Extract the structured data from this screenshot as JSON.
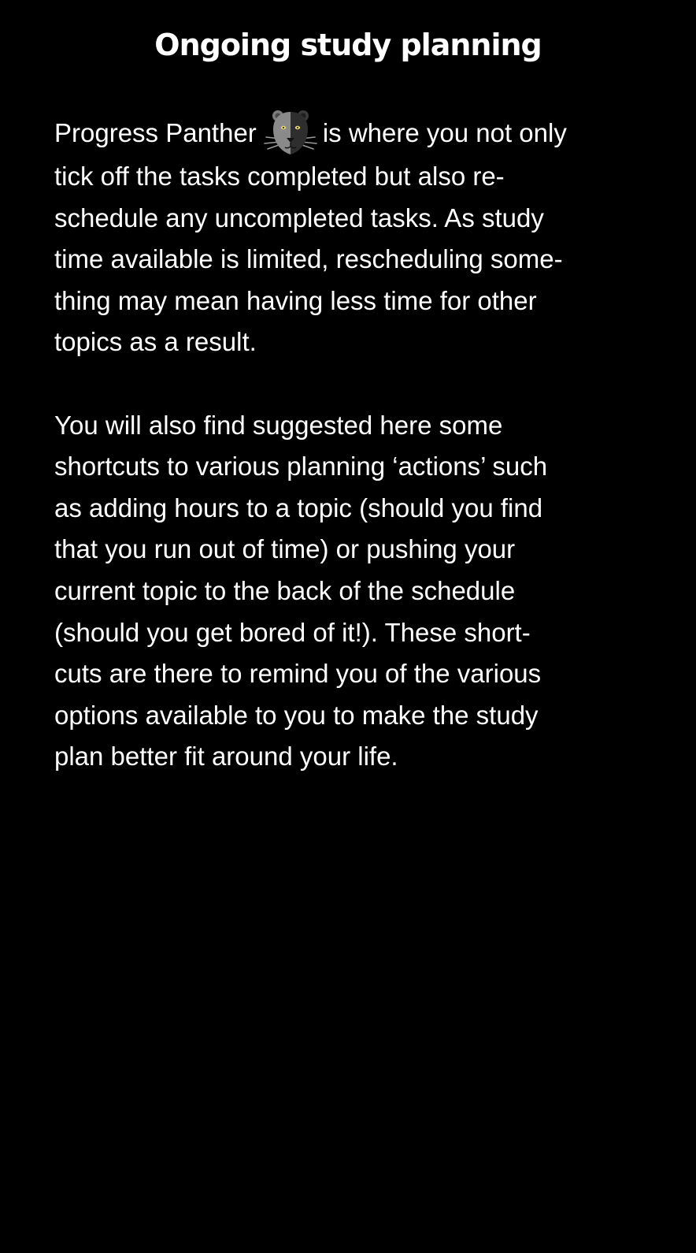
{
  "title": "Ongoing study planning",
  "paragraph1": {
    "lead": "Progress Panther",
    "icon": "panther-icon",
    "lines": [
      "is where you not only",
      "tick off the tasks completed but also re-",
      "schedule any uncompleted tasks. As study",
      "time available is limited, rescheduling some-",
      "thing may mean having less time for other",
      "topics as a result."
    ]
  },
  "paragraph2": {
    "lines": [
      "You will also find suggested here some",
      "shortcuts to various planning ‘actions’ such",
      "as adding hours to a topic (should you find",
      "that you run out of time) or pushing your",
      "current topic to the back of the schedule",
      "(should you get bored of it!).  These short-",
      "cuts are there to remind you of the various",
      "options available to you to make the study",
      "plan better fit around your life."
    ]
  },
  "colors": {
    "background": "#000000",
    "text": "#ffffff",
    "panther_light": "#8a8a8a",
    "panther_dark": "#2e2e2e",
    "panther_eye": "#e6d86a"
  }
}
